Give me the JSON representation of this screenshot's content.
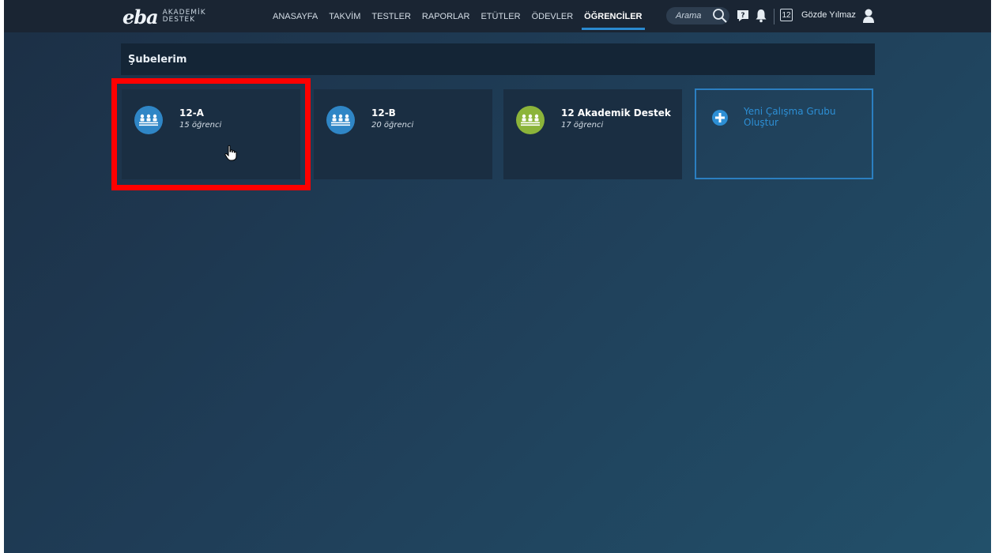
{
  "header": {
    "logo_main": "eba",
    "logo_sub_top": "AKADEMİK",
    "logo_sub_bottom": "DESTEK",
    "nav": [
      {
        "label": "ANASAYFA",
        "active": false
      },
      {
        "label": "TAKVİM",
        "active": false
      },
      {
        "label": "TESTLER",
        "active": false
      },
      {
        "label": "RAPORLAR",
        "active": false
      },
      {
        "label": "ETÜTLER",
        "active": false
      },
      {
        "label": "ÖDEVLER",
        "active": false
      },
      {
        "label": "ÖĞRENCİLER",
        "active": true
      }
    ],
    "search": {
      "placeholder": "Arama",
      "icon": "search-icon"
    },
    "help_icon": "help-icon",
    "notifications_icon": "bell-icon",
    "calendar_day": "12",
    "username": "Gözde Yılmaz",
    "user_icon": "user-icon"
  },
  "main": {
    "section_title": "Şubelerim",
    "classes": [
      {
        "name": "12-A",
        "count": "15 öğrenci",
        "color": "#2f86c6",
        "icon": "students-icon",
        "highlighted": true
      },
      {
        "name": "12-B",
        "count": "20 öğrenci",
        "color": "#2f86c6",
        "icon": "students-icon",
        "highlighted": false
      },
      {
        "name": "12 Akademik Destek",
        "count": "17 öğrenci",
        "color": "#8cb43a",
        "icon": "students-icon",
        "highlighted": false
      }
    ],
    "new_group": {
      "label": "Yeni Çalışma Grubu Oluştur",
      "icon": "plus-icon"
    }
  },
  "colors": {
    "accent": "#2a8ad0",
    "highlight_box": "#ff0000",
    "topbar": "#1a2533",
    "card": "#1a2e42"
  }
}
